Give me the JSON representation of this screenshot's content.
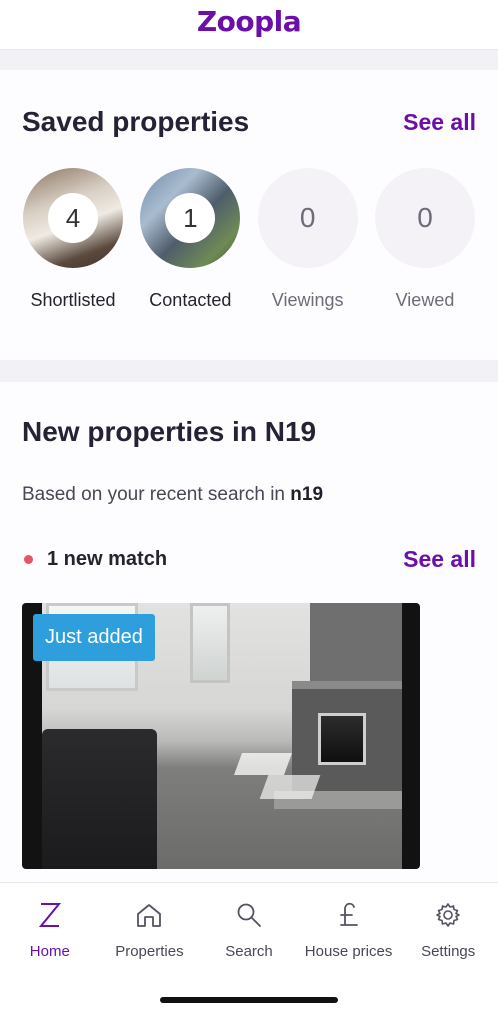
{
  "app": {
    "logo": "Zoopla"
  },
  "saved": {
    "title": "Saved properties",
    "see_all": "See all",
    "items": [
      {
        "label": "Shortlisted",
        "count": "4"
      },
      {
        "label": "Contacted",
        "count": "1"
      },
      {
        "label": "Viewings",
        "count": "0"
      },
      {
        "label": "Viewed",
        "count": "0"
      }
    ]
  },
  "new_props": {
    "title": "New properties in N19",
    "based_prefix": "Based on your recent search in ",
    "based_area": "n19",
    "match_text": "1 new match",
    "see_all": "See all",
    "listing": {
      "badge": "Just added"
    }
  },
  "tabs": [
    {
      "label": "Home",
      "icon": "z-logo-icon",
      "active": true
    },
    {
      "label": "Properties",
      "icon": "house-icon"
    },
    {
      "label": "Search",
      "icon": "search-icon"
    },
    {
      "label": "House prices",
      "icon": "pound-icon"
    },
    {
      "label": "Settings",
      "icon": "gear-icon"
    }
  ],
  "colors": {
    "brand": "#6b0fa8",
    "badge": "#2e9fdc",
    "dot": "#e45566"
  }
}
